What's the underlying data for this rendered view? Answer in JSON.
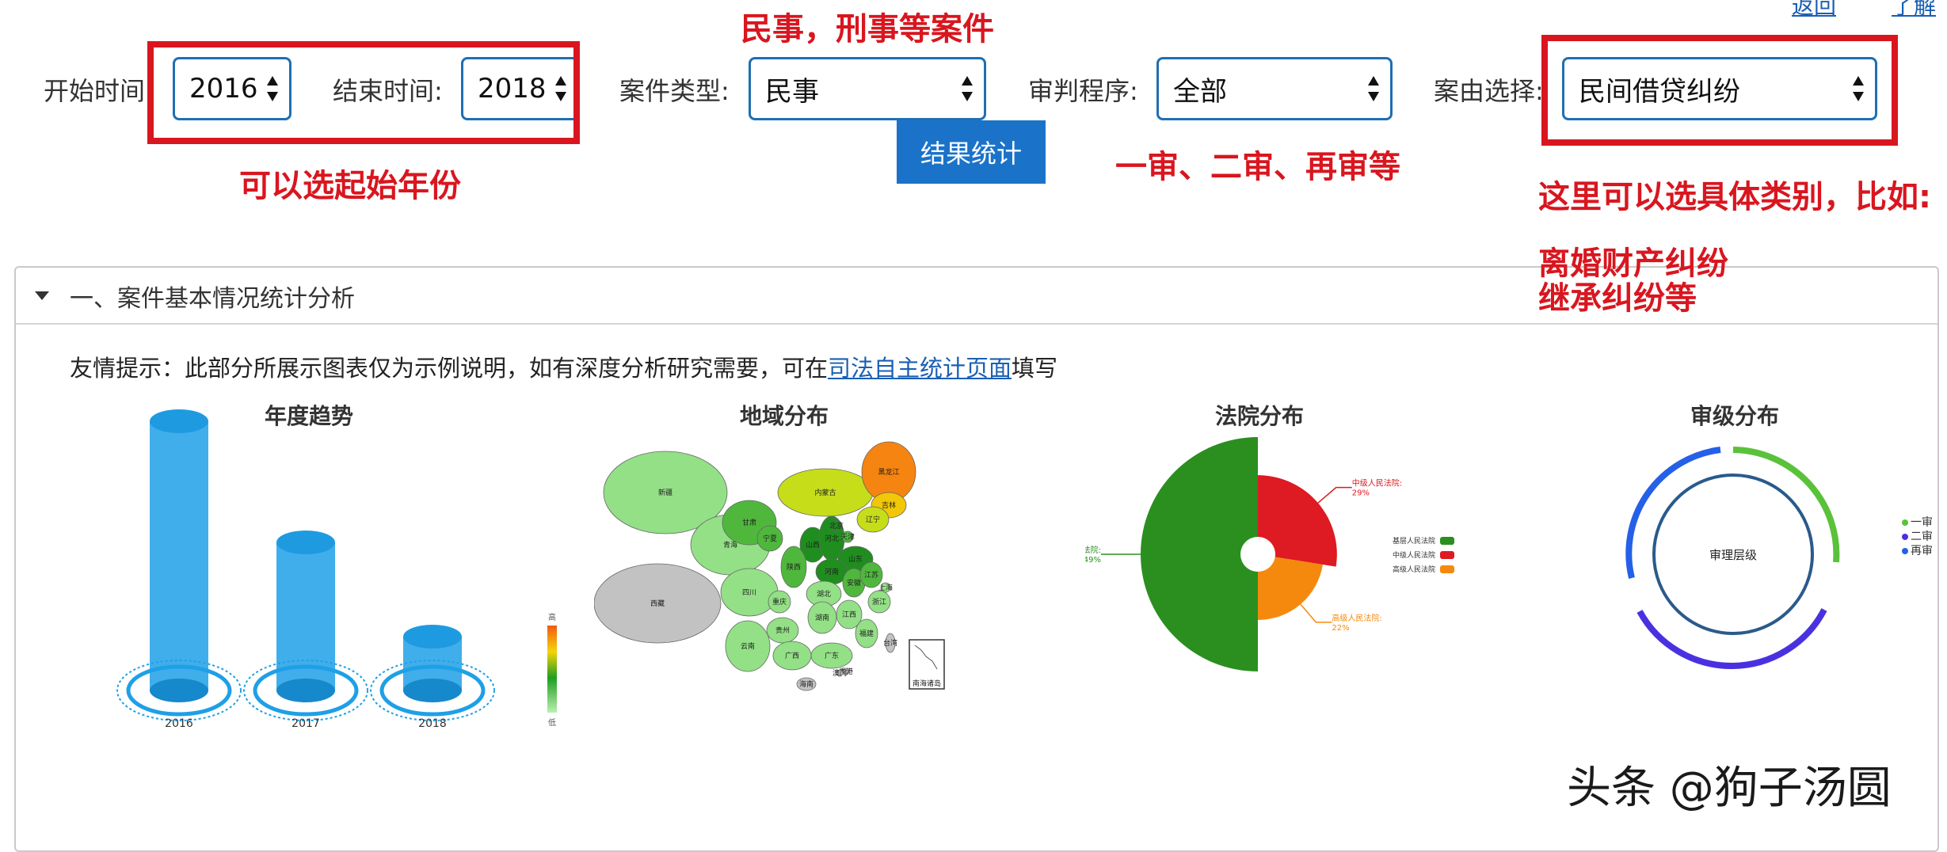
{
  "top_links": [
    "返回",
    "了解"
  ],
  "filters": {
    "start_label": "开始时间",
    "start_value": "2016",
    "end_label": "结束时间:",
    "end_value": "2018",
    "case_type_label": "案件类型:",
    "case_type_value": "民事",
    "procedure_label": "审判程序:",
    "procedure_value": "全部",
    "cause_label": "案由选择:",
    "cause_value": "民间借贷纠纷",
    "stats_button": "结果统计"
  },
  "annotations": {
    "case_type_note": "民事，刑事等案件",
    "year_note": "可以选起始年份",
    "procedure_note": "一审、二审、再审等",
    "cause_note_1": "这里可以选具体类别，比如:",
    "cause_note_2": "离婚财产纠纷",
    "cause_note_3": "继承纠纷等"
  },
  "section": {
    "title": "一、案件基本情况统计分析",
    "tip_prefix": "友情提示：此部分所展示图表仅为示例说明，如有深度分析研究需要，可在",
    "tip_link": "司法自主统计页面",
    "tip_suffix": "填写"
  },
  "chart_data": [
    {
      "type": "bar",
      "title": "年度趋势",
      "categories": [
        "2016",
        "2017",
        "2018"
      ],
      "values": [
        100,
        55,
        20
      ],
      "ylim": [
        0,
        100
      ],
      "color": "#1ea0e6"
    },
    {
      "type": "heatmap",
      "title": "地域分布",
      "legend_high": "高",
      "legend_low": "低",
      "regions": [
        {
          "name": "新疆",
          "level": 0.15
        },
        {
          "name": "西藏",
          "level": 0.0
        },
        {
          "name": "青海",
          "level": 0.05
        },
        {
          "name": "甘肃",
          "level": 0.2
        },
        {
          "name": "内蒙古",
          "level": 0.55
        },
        {
          "name": "宁夏",
          "level": 0.25
        },
        {
          "name": "黑龙江",
          "level": 0.9
        },
        {
          "name": "吉林",
          "level": 0.6
        },
        {
          "name": "辽宁",
          "level": 0.45
        },
        {
          "name": "山西",
          "level": 0.4
        },
        {
          "name": "河北",
          "level": 0.35
        },
        {
          "name": "北京",
          "level": 0.35
        },
        {
          "name": "天津",
          "level": 0.3
        },
        {
          "name": "山东",
          "level": 0.4
        },
        {
          "name": "河南",
          "level": 0.4
        },
        {
          "name": "陕西",
          "level": 0.25
        },
        {
          "name": "四川",
          "level": 0.15
        },
        {
          "name": "重庆",
          "level": 0.15
        },
        {
          "name": "湖北",
          "level": 0.1
        },
        {
          "name": "安徽",
          "level": 0.3
        },
        {
          "name": "江苏",
          "level": 0.2
        },
        {
          "name": "上海",
          "level": 0.1
        },
        {
          "name": "浙江",
          "level": 0.1
        },
        {
          "name": "江西",
          "level": 0.05
        },
        {
          "name": "湖南",
          "level": 0.05
        },
        {
          "name": "贵州",
          "level": 0.15
        },
        {
          "name": "云南",
          "level": 0.15
        },
        {
          "name": "广西",
          "level": 0.1
        },
        {
          "name": "广东",
          "level": 0.05
        },
        {
          "name": "福建",
          "level": 0.05
        },
        {
          "name": "台湾",
          "level": 0.0
        },
        {
          "name": "海南",
          "level": 0.0
        },
        {
          "name": "香港",
          "level": 0.0
        },
        {
          "name": "澳门",
          "level": 0.0
        }
      ],
      "inset_label": "南海诸岛"
    },
    {
      "type": "pie",
      "title": "法院分布",
      "slices": [
        {
          "name": "基层人民法院",
          "value": 49,
          "label": "49%",
          "color": "#2a8f1f"
        },
        {
          "name": "中级人民法院",
          "value": 29,
          "label": "29%",
          "color": "#de1a22"
        },
        {
          "name": "高级人民法院",
          "value": 22,
          "label": "22%",
          "color": "#f5890d"
        }
      ],
      "legend": [
        "基层人民法院",
        "中级人民法院",
        "高级人民法院"
      ]
    },
    {
      "type": "pie",
      "title": "审级分布",
      "center_label": "审理层级",
      "series": [
        {
          "name": "一审",
          "color": "#5ac23a"
        },
        {
          "name": "二审",
          "color": "#4a31e0"
        },
        {
          "name": "再审",
          "color": "#2460e8"
        }
      ]
    }
  ],
  "watermark": "头条 @狗子汤圆"
}
